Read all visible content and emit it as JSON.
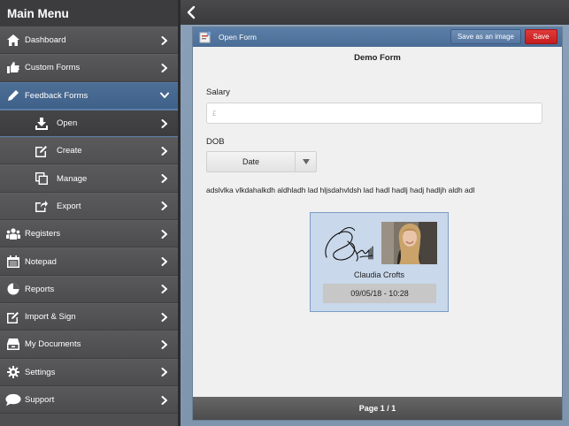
{
  "sidebar": {
    "title": "Main Menu",
    "items": [
      {
        "label": "Dashboard",
        "icon": "home-icon"
      },
      {
        "label": "Custom Forms",
        "icon": "thumbs-up-icon"
      },
      {
        "label": "Feedback Forms",
        "icon": "pencil-icon",
        "active": true,
        "expanded": true
      },
      {
        "label": "Open",
        "icon": "download-icon",
        "sub": true,
        "active": true
      },
      {
        "label": "Create",
        "icon": "edit-icon",
        "sub": true
      },
      {
        "label": "Manage",
        "icon": "copy-icon",
        "sub": true
      },
      {
        "label": "Export",
        "icon": "export-icon",
        "sub": true
      },
      {
        "label": "Registers",
        "icon": "people-icon"
      },
      {
        "label": "Notepad",
        "icon": "calendar-icon"
      },
      {
        "label": "Reports",
        "icon": "pie-chart-icon"
      },
      {
        "label": "Import & Sign",
        "icon": "sign-icon"
      },
      {
        "label": "My Documents",
        "icon": "drawer-icon"
      },
      {
        "label": "Settings",
        "icon": "gear-icon"
      },
      {
        "label": "Support",
        "icon": "chat-bubble-icon"
      }
    ]
  },
  "panel": {
    "title": "Open Form",
    "save_image_label": "Save as an image",
    "save_label": "Save",
    "form_title": "Demo Form",
    "salary_label": "Salary",
    "salary_placeholder": "£",
    "dob_label": "DOB",
    "date_select_value": "Date",
    "paragraph": "adslvlka vlkdahalkdh aldhladh lad hljsdahvldsh lad hadl hadlj hadj hadljh aldh adl",
    "signature": {
      "name": "Claudia Crofts",
      "datetime": "09/05/18 - 10:28"
    },
    "footer": "Page 1 / 1"
  },
  "colors": {
    "sidebar_bg": "#4f4f51",
    "active_blue": "#4a6d96",
    "save_red": "#d02a2a",
    "card_bg": "#c9d8ea"
  }
}
